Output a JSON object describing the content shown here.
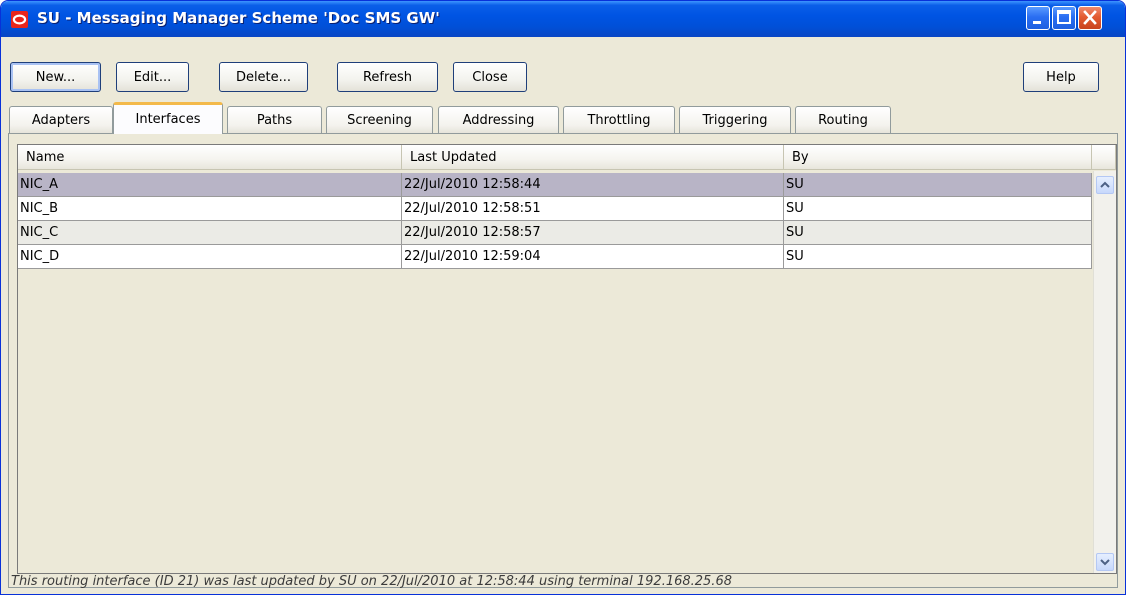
{
  "window": {
    "title": "SU - Messaging Manager Scheme 'Doc SMS GW'",
    "controls": [
      "minimize-icon",
      "maximize-icon",
      "close-icon"
    ]
  },
  "toolbar": {
    "new_label": "New...",
    "edit_label": "Edit...",
    "delete_label": "Delete...",
    "refresh_label": "Refresh",
    "close_label": "Close",
    "help_label": "Help"
  },
  "tabs": [
    {
      "label": "Adapters",
      "active": false
    },
    {
      "label": "Interfaces",
      "active": true
    },
    {
      "label": "Paths",
      "active": false
    },
    {
      "label": "Screening",
      "active": false
    },
    {
      "label": "Addressing",
      "active": false
    },
    {
      "label": "Throttling",
      "active": false
    },
    {
      "label": "Triggering",
      "active": false
    },
    {
      "label": "Routing",
      "active": false
    }
  ],
  "table": {
    "columns": [
      "Name",
      "Last Updated",
      "By"
    ],
    "rows": [
      {
        "name": "NIC_A",
        "updated": "22/Jul/2010 12:58:44",
        "by": "SU",
        "selected": true
      },
      {
        "name": "NIC_B",
        "updated": "22/Jul/2010 12:58:51",
        "by": "SU",
        "selected": false
      },
      {
        "name": "NIC_C",
        "updated": "22/Jul/2010 12:58:57",
        "by": "SU",
        "selected": false
      },
      {
        "name": "NIC_D",
        "updated": "22/Jul/2010 12:59:04",
        "by": "SU",
        "selected": false
      }
    ]
  },
  "status": {
    "text": "This routing interface (ID 21) was last updated by SU on 22/Jul/2010 at 12:58:44 using terminal 192.168.25.68"
  },
  "colors": {
    "titlebar": "#0054e3",
    "window_bg": "#ece9d8",
    "selected_row": "#b8b4c6",
    "active_tab_accent": "#f3b94a",
    "close_button": "#e35b31"
  }
}
